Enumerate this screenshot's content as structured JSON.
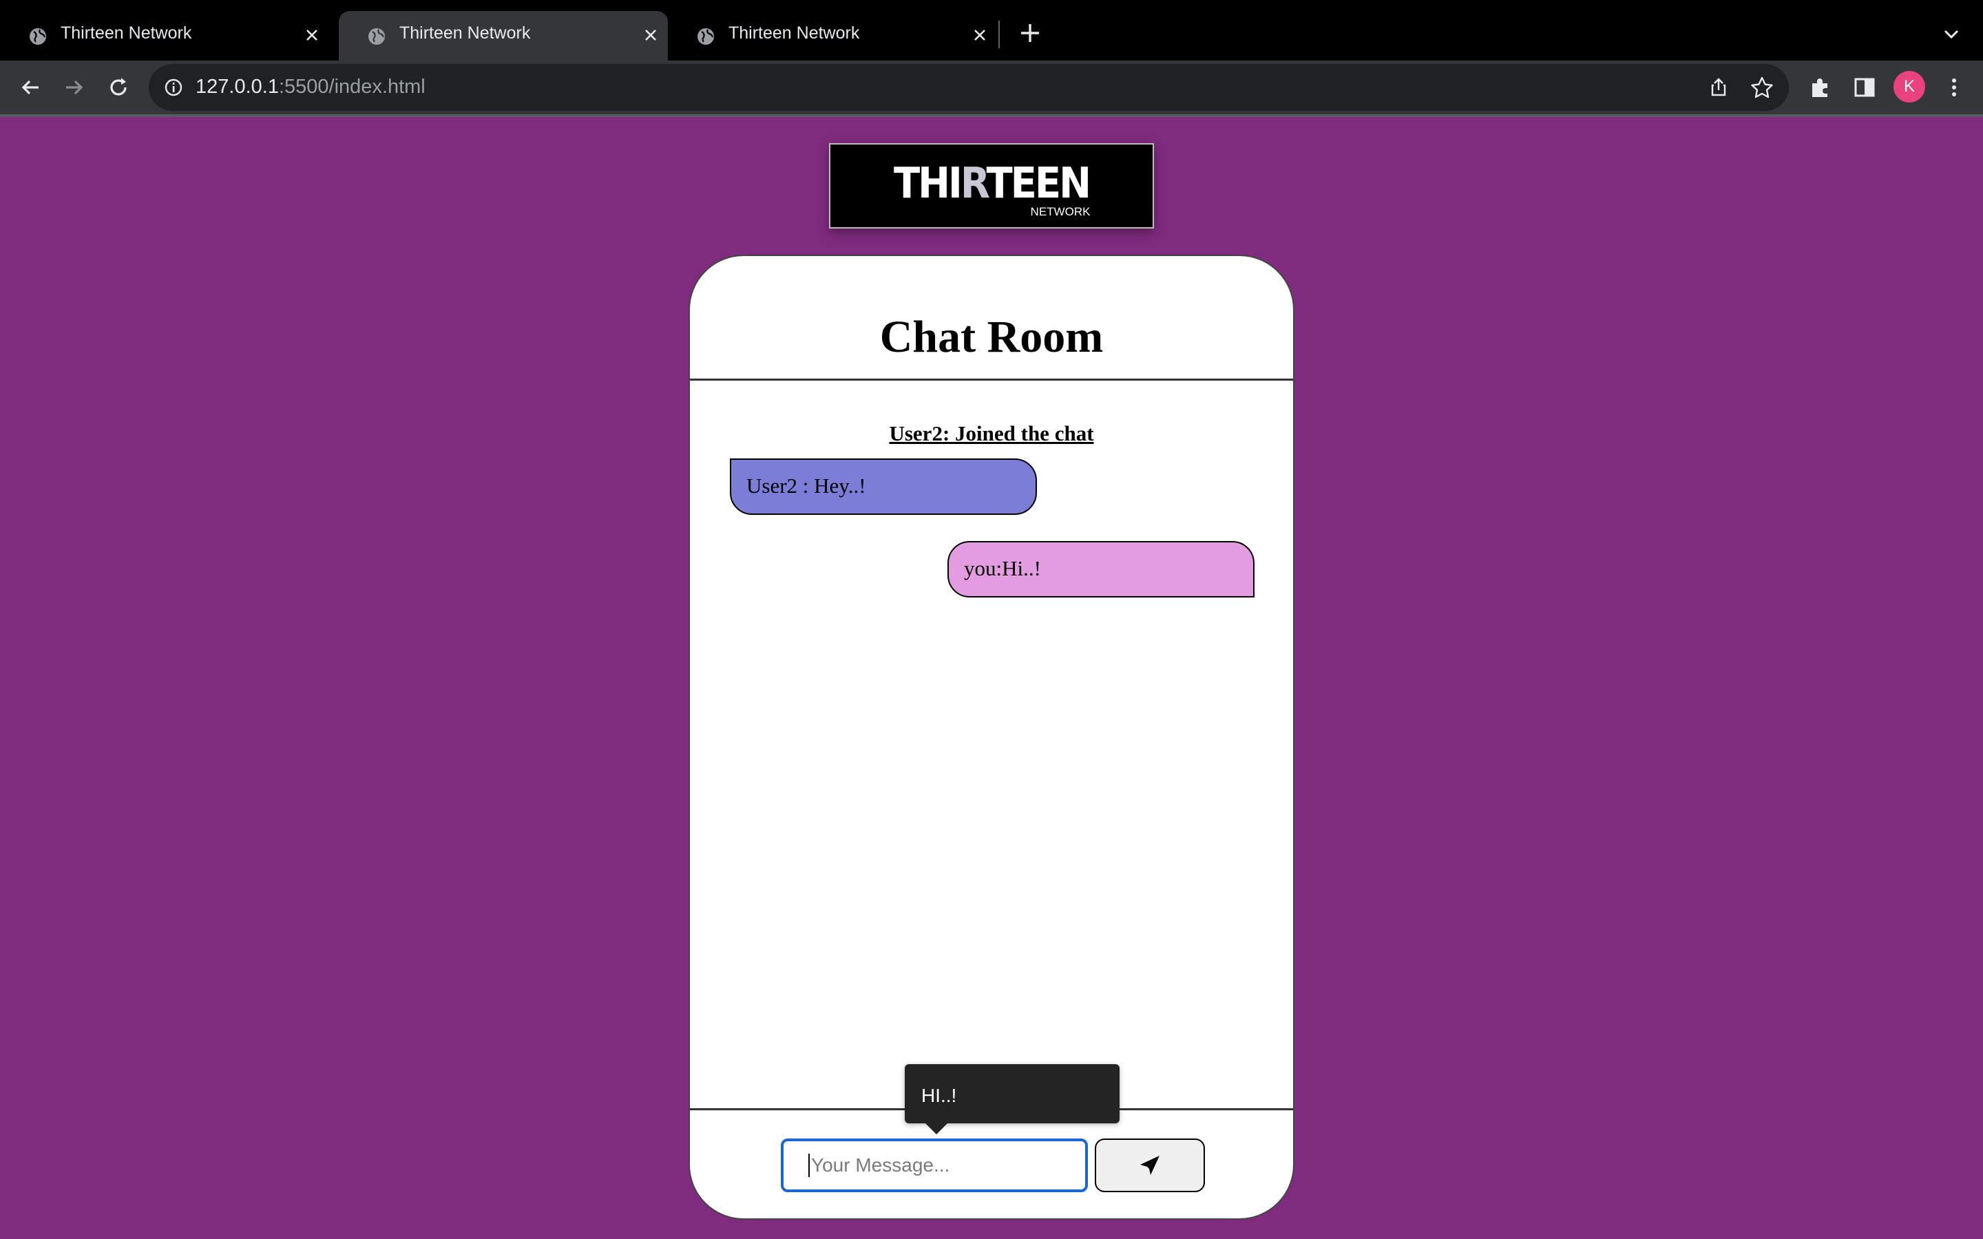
{
  "browser": {
    "tabs": [
      {
        "title": "Thirteen Network",
        "active": false
      },
      {
        "title": "Thirteen Network",
        "active": true
      },
      {
        "title": "Thirteen Network",
        "active": false
      }
    ],
    "url_host": "127.0.0.1",
    "url_rest": ":5500/index.html",
    "profile_initial": "K",
    "profile_color": "#e8437f"
  },
  "logo": {
    "main_before": "THI",
    "main_r": "R",
    "main_after": "TEEN",
    "sub": "NETWORK"
  },
  "chat": {
    "title": "Chat Room",
    "system_message": "User2: Joined the chat",
    "messages": [
      {
        "direction": "incoming",
        "text": "User2 : Hey..!",
        "color": "#7b7dd6"
      },
      {
        "direction": "outgoing",
        "text": "you:Hi..!",
        "color": "#e49ce0"
      }
    ],
    "autofill_suggestion": "HI..!",
    "input_placeholder": "Your Message...",
    "send_icon": "paper-plane-icon"
  },
  "colors": {
    "page_background": "#7f2b7e",
    "input_focus": "#1a67d2"
  }
}
